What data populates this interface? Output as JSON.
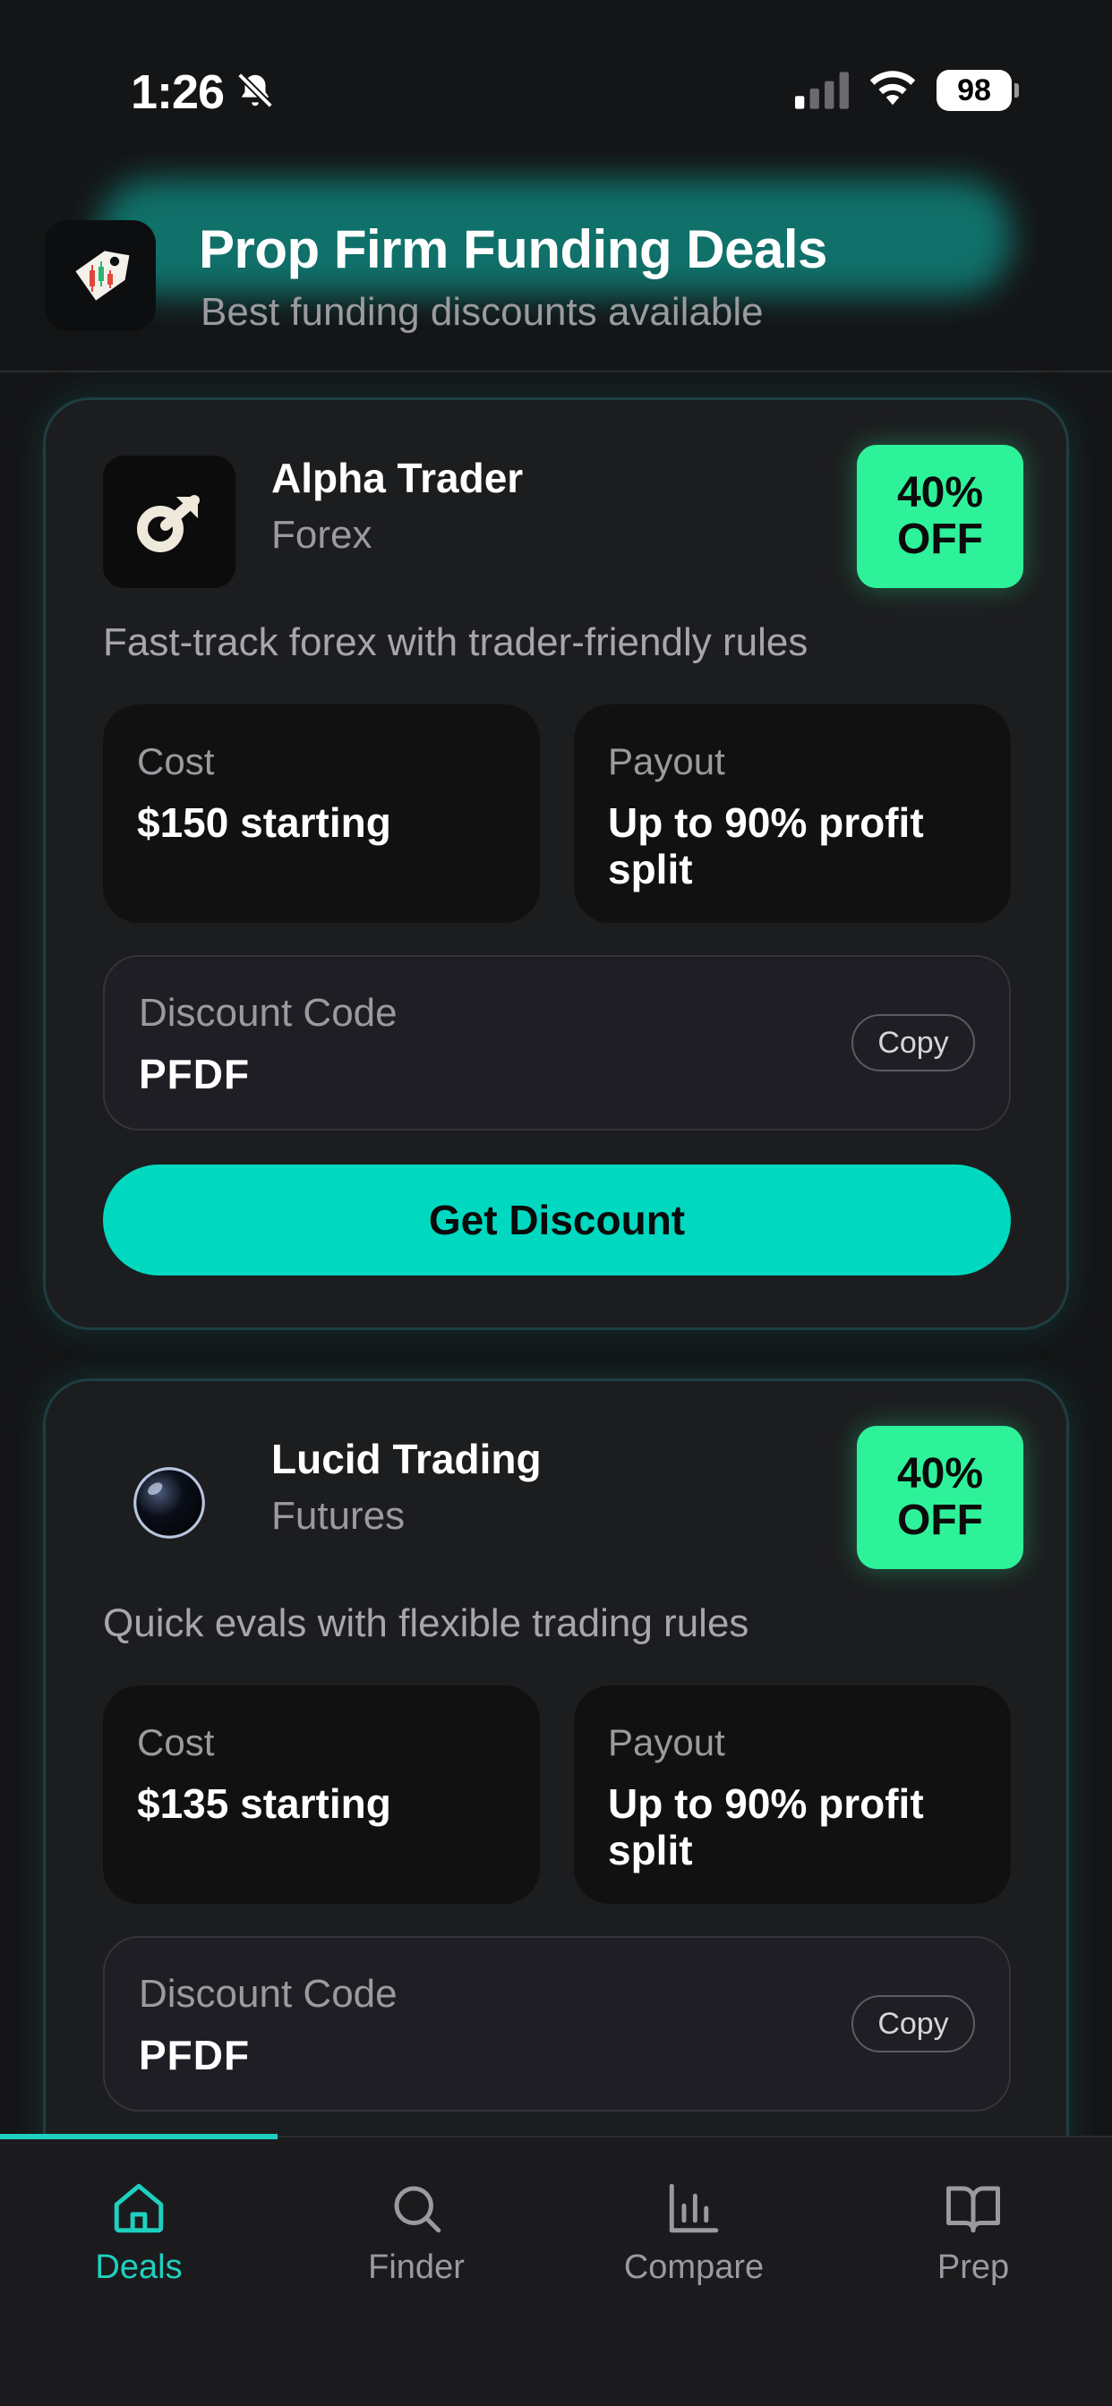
{
  "status_bar": {
    "time": "1:26",
    "battery": "98",
    "icons": [
      "bell-slash-icon",
      "cellular-signal-icon",
      "wifi-icon",
      "battery-icon"
    ]
  },
  "header": {
    "title": "Prop Firm Funding Deals",
    "subtitle": "Best funding discounts available",
    "logo_icon": "price-tag-chart-icon"
  },
  "deals": [
    {
      "name": "Alpha Trader",
      "category": "Forex",
      "logo_icon": "alpha-trader-arrow-logo",
      "badge_line1": "40%",
      "badge_line2": "OFF",
      "description": "Fast-track forex with trader-friendly rules",
      "cost_label": "Cost",
      "cost_value": "$150 starting",
      "payout_label": "Payout",
      "payout_value": "Up to 90% profit split",
      "code_label": "Discount Code",
      "code_value": "PFDF",
      "copy_label": "Copy",
      "button_label": "Get Discount"
    },
    {
      "name": "Lucid Trading",
      "category": "Futures",
      "logo_icon": "lucid-sphere-logo",
      "badge_line1": "40%",
      "badge_line2": "OFF",
      "description": "Quick evals with flexible trading rules",
      "cost_label": "Cost",
      "cost_value": "$135 starting",
      "payout_label": "Payout",
      "payout_value": "Up to 90% profit split",
      "code_label": "Discount Code",
      "code_value": "PFDF",
      "copy_label": "Copy"
    }
  ],
  "nav": {
    "items": [
      {
        "label": "Deals",
        "icon": "home-icon",
        "active": true
      },
      {
        "label": "Finder",
        "icon": "search-icon",
        "active": false
      },
      {
        "label": "Compare",
        "icon": "bar-chart-icon",
        "active": false
      },
      {
        "label": "Prep",
        "icon": "book-icon",
        "active": false
      }
    ]
  },
  "colors": {
    "accent": "#00d9c0",
    "badge": "#2ef29a",
    "background": "#141516",
    "card": "#1c1d1f"
  }
}
